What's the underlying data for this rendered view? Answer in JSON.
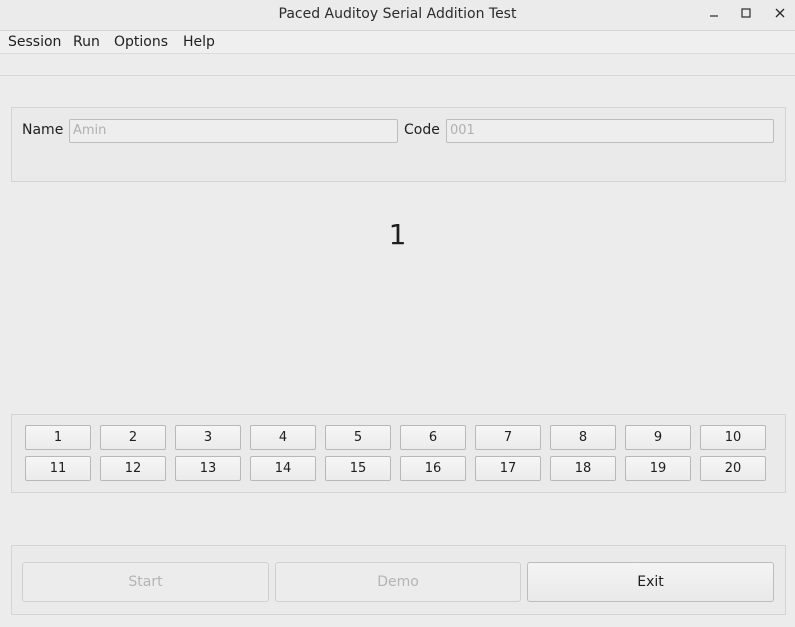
{
  "window": {
    "title": "Paced Auditoy Serial Addition Test",
    "minimize": "_",
    "maximize": "☐",
    "close": "×"
  },
  "menu": {
    "items": [
      "Session",
      "Run",
      "Options",
      "Help"
    ]
  },
  "form": {
    "name_label": "Name",
    "name_value": "Amin",
    "code_label": "Code",
    "code_value": "001"
  },
  "display": {
    "current_number": "1"
  },
  "number_buttons": [
    "1",
    "2",
    "3",
    "4",
    "5",
    "6",
    "7",
    "8",
    "9",
    "10",
    "11",
    "12",
    "13",
    "14",
    "15",
    "16",
    "17",
    "18",
    "19",
    "20"
  ],
  "actions": {
    "start_label": "Start",
    "demo_label": "Demo",
    "exit_label": "Exit"
  }
}
